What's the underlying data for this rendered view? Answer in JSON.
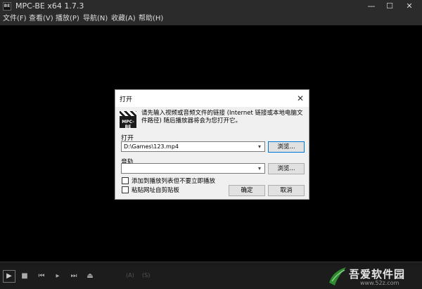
{
  "app": {
    "title": "MPC-BE x64 1.7.3",
    "icon_label": "BE"
  },
  "window_controls": {
    "minimize": "—",
    "maximize": "☐",
    "close": "✕"
  },
  "menu": [
    "文件(F)",
    "查看(V)",
    "播放(P)",
    "导航(N)",
    "收藏(A)",
    "帮助(H)"
  ],
  "controls": {
    "play": "▶",
    "stop": "■",
    "prev": "⏮",
    "frame": "▸",
    "next": "⏭",
    "eject": "⏏",
    "audio_status": "(A)",
    "subtitle_status": "(S)"
  },
  "watermark": {
    "text": "吾爱软件园",
    "url": "www.52z.com"
  },
  "dialog": {
    "title": "打开",
    "close": "✕",
    "icon_label": "MPC-BE",
    "message": "请先输入视频或音频文件的链接 (Internet 链接或本地电脑文件路径) 随后播放器将会为您打开它。",
    "open_label": "打开",
    "open_value": "D:\\Games\\123.mp4",
    "browse1": "浏览...",
    "audio_label": "音轨",
    "audio_value": "",
    "browse2": "浏览...",
    "checkbox1": "添加到播放列表但不要立即播放",
    "checkbox2": "粘贴网址自剪贴板",
    "checkbox1_checked": false,
    "checkbox2_checked": false,
    "ok": "确定",
    "cancel": "取消"
  }
}
